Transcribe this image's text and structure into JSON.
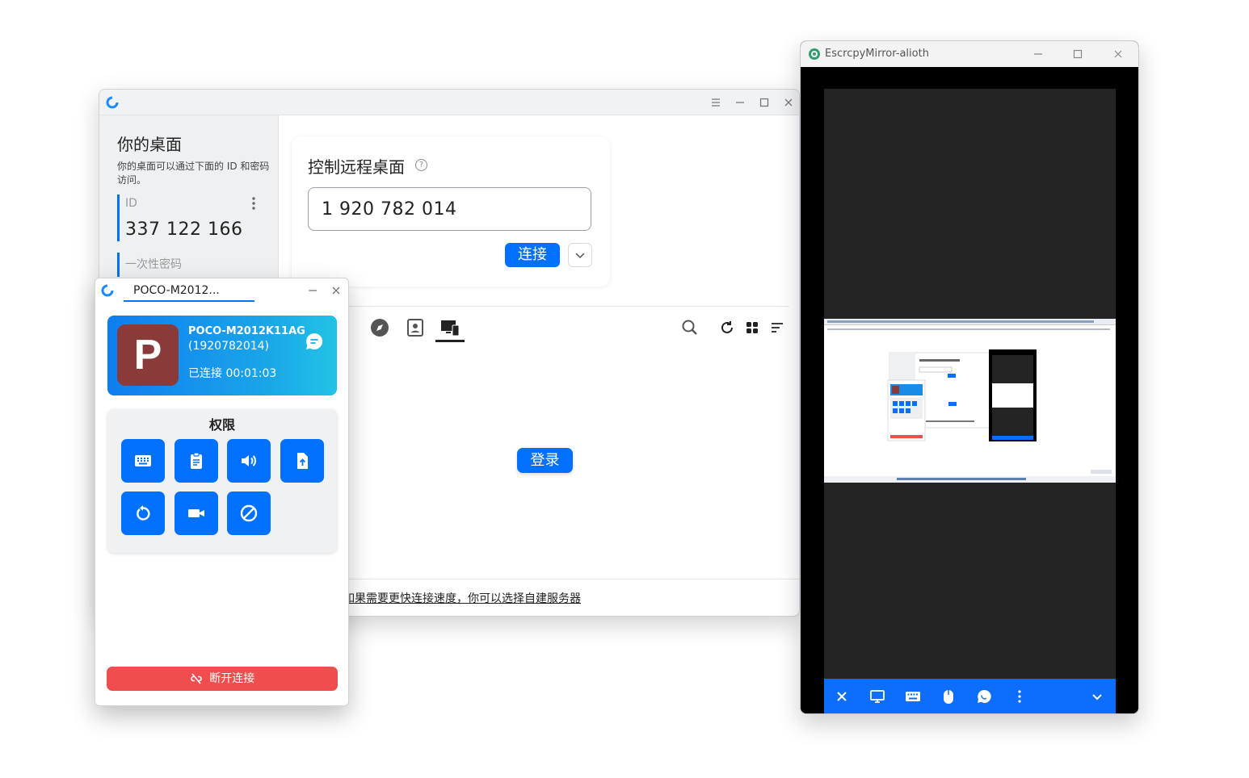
{
  "main_window": {
    "sidebar": {
      "title": "你的桌面",
      "description": "你的桌面可以通过下面的 ID 和密码访问。",
      "id_label": "ID",
      "id_value": "337 122 166",
      "password_label": "一次性密码"
    },
    "connect_card": {
      "title": "控制远程桌面",
      "input_value": "1 920 782 014",
      "connect_label": "连接"
    },
    "login_label": "登录",
    "bottom_link": "如果需要更快连接速度，你可以选择自建服务器"
  },
  "cm_window": {
    "tab_label": "POCO-M2012...",
    "avatar_letter": "P",
    "device_name": "POCO-M2012K11AG",
    "device_id": "(1920782014)",
    "status": "已连接   00:01:03",
    "permissions_title": "权限",
    "permissions": [
      "keyboard-icon",
      "clipboard-icon",
      "audio-icon",
      "file-icon",
      "restart-icon",
      "record-icon",
      "block-icon"
    ],
    "disconnect_label": "断开连接"
  },
  "escrcpy_window": {
    "title": "EscrcpyMirror-alioth",
    "toolbar_icons": [
      "close-icon",
      "monitor-icon",
      "keyboard-icon",
      "mouse-icon",
      "chat-icon",
      "more-icon",
      "chevron-down-icon"
    ]
  },
  "colors": {
    "accent": "#0071ff",
    "danger": "#f04e4e",
    "escrcpy_bar": "#0d6efd"
  }
}
